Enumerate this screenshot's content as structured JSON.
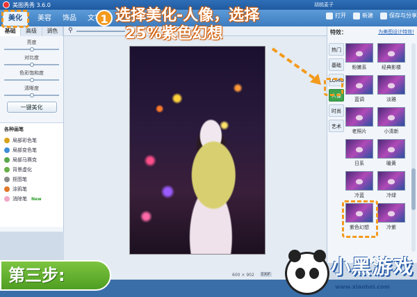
{
  "app": {
    "title": "美图秀秀 3.6.0",
    "user": "胡桃麦子"
  },
  "menu": {
    "tabs": [
      "美化",
      "美容",
      "饰品",
      "文字"
    ],
    "active": "美化"
  },
  "right_tools": {
    "open": "打开",
    "new": "新建",
    "save_share": "保存与分享"
  },
  "left_panel": {
    "subtabs": [
      "基础",
      "高级",
      "调色"
    ],
    "sliders": [
      {
        "label": "亮度",
        "value": 0.5
      },
      {
        "label": "对比度",
        "value": 0.5
      },
      {
        "label": "色彩饱和度",
        "value": 0.5
      },
      {
        "label": "清晰度",
        "value": 0.5
      }
    ],
    "one_click": "一键美化",
    "brush_title": "各种画笔",
    "brushes": [
      {
        "label": "局部彩色笔",
        "color": "#d9a21b"
      },
      {
        "label": "局部变色笔",
        "color": "#3e8ed8"
      },
      {
        "label": "局部马赛克",
        "color": "#58a84a"
      },
      {
        "label": "背景虚化",
        "color": "#6ab04a"
      },
      {
        "label": "抠图笔",
        "color": "#8a8a8a"
      },
      {
        "label": "涂鸦笔",
        "color": "#e0782a"
      },
      {
        "label": "消除笔",
        "color": "#f2a8c8"
      }
    ],
    "new_badge": "New"
  },
  "canvas": {
    "size_w": "600",
    "size_x": "×",
    "size_h": "902",
    "exif": "EXIF"
  },
  "right_panel": {
    "title": "特效：",
    "link": "为美图设计特效!",
    "vtabs": [
      "热门",
      "基础",
      "LOMO",
      "人像",
      "时尚",
      "艺术"
    ],
    "active_vtab": "人像",
    "effects": [
      "粉嫩系",
      "经典影楼",
      "蓝调",
      "淡雅",
      "老照片",
      "小清新",
      "日系",
      "暖黄",
      "冷蓝",
      "冷绿",
      "紫色幻想",
      "冷紫"
    ]
  },
  "overlay": {
    "step_number": "1",
    "instruction_line1": "选择美化-人像，选择",
    "instruction_line2": "25%紫色幻想",
    "step_label": "第三步:",
    "brand_name": "小黑游戏",
    "brand_url": "www.xiaohei.com",
    "accent": "#f39a1c"
  }
}
